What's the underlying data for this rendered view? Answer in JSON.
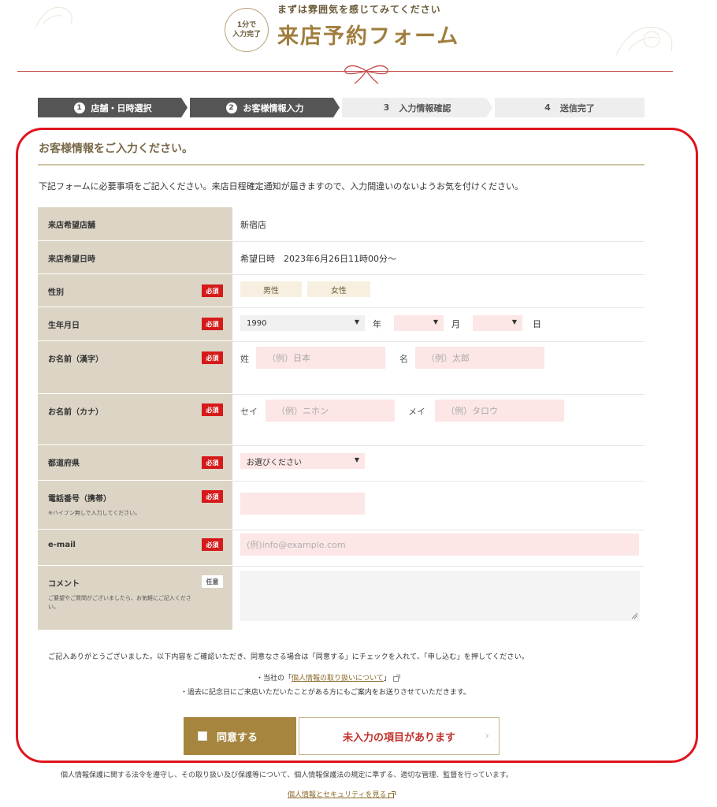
{
  "header": {
    "badge_line1": "1分で",
    "badge_line2": "入力完了",
    "tagline": "まずは雰囲気を感じてみてください",
    "title": "来店予約フォーム"
  },
  "steps": [
    {
      "num": "1",
      "label": "店舗・日時選択"
    },
    {
      "num": "2",
      "label": "お客様情報入力"
    },
    {
      "num": "3",
      "label": "入力情報確認"
    },
    {
      "num": "4",
      "label": "送信完了"
    }
  ],
  "section": {
    "title": "お客様情報をご入力ください。",
    "intro": "下記フォームに必要事項をご記入ください。来店日程確定通知が届きますので、入力間違いのないようお気を付けください。"
  },
  "badges": {
    "required": "必須",
    "optional": "任意"
  },
  "form": {
    "store": {
      "label": "来店希望店舗",
      "value": "新宿店"
    },
    "datetime": {
      "label": "来店希望日時",
      "value": "希望日時　2023年6月26日11時00分～"
    },
    "gender": {
      "label": "性別",
      "male": "男性",
      "female": "女性"
    },
    "birthday": {
      "label": "生年月日",
      "year": "1990",
      "year_unit": "年",
      "month": "",
      "month_unit": "月",
      "day": "",
      "day_unit": "日"
    },
    "name_kanji": {
      "label": "お名前（漢字）",
      "last_label": "姓",
      "last_placeholder": "（例）日本",
      "first_label": "名",
      "first_placeholder": "（例）太郎"
    },
    "name_kana": {
      "label": "お名前（カナ）",
      "last_label": "セイ",
      "last_placeholder": "（例）ニホン",
      "first_label": "メイ",
      "first_placeholder": "（例）タロウ"
    },
    "prefecture": {
      "label": "都道府県",
      "value": "お選びください"
    },
    "phone": {
      "label": "電話番号（携帯）",
      "note": "※ハイフン無しで入力してください。",
      "value": ""
    },
    "email": {
      "label": "e-mail",
      "placeholder": "(例)info@example.com"
    },
    "comment": {
      "label": "コメント",
      "note": "ご要望やご質問がございましたら、お気軽にご記入ください。",
      "value": ""
    }
  },
  "notes": {
    "line1": "ご記入ありがとうございました。以下内容をご確認いただき、同意なさる場合は「同意する」にチェックを入れて、「申し込む」を押してください。",
    "line2_prefix": "・当社の「",
    "line2_link": "個人情報の取り扱いについて",
    "line2_suffix": "」",
    "line3": "・過去に記念日にご来店いただいたことがある方にもご案内をお送りさせていただきます。"
  },
  "buttons": {
    "agree": "同意する",
    "submit": "未入力の項目があります"
  },
  "footer": {
    "text": "個人情報保護に関する法令を遵守し、その取り扱い及び保護等について、個人情報保護法の規定に準ずる、適切な管理、監督を行っています。",
    "link": "個人情報とセキュリティを見る"
  },
  "colors": {
    "accent": "#a6853e",
    "required": "#d51a1a",
    "highlight": "#e0141e",
    "label_bg": "#dcd4c5",
    "input_bg": "#fde6e6"
  }
}
